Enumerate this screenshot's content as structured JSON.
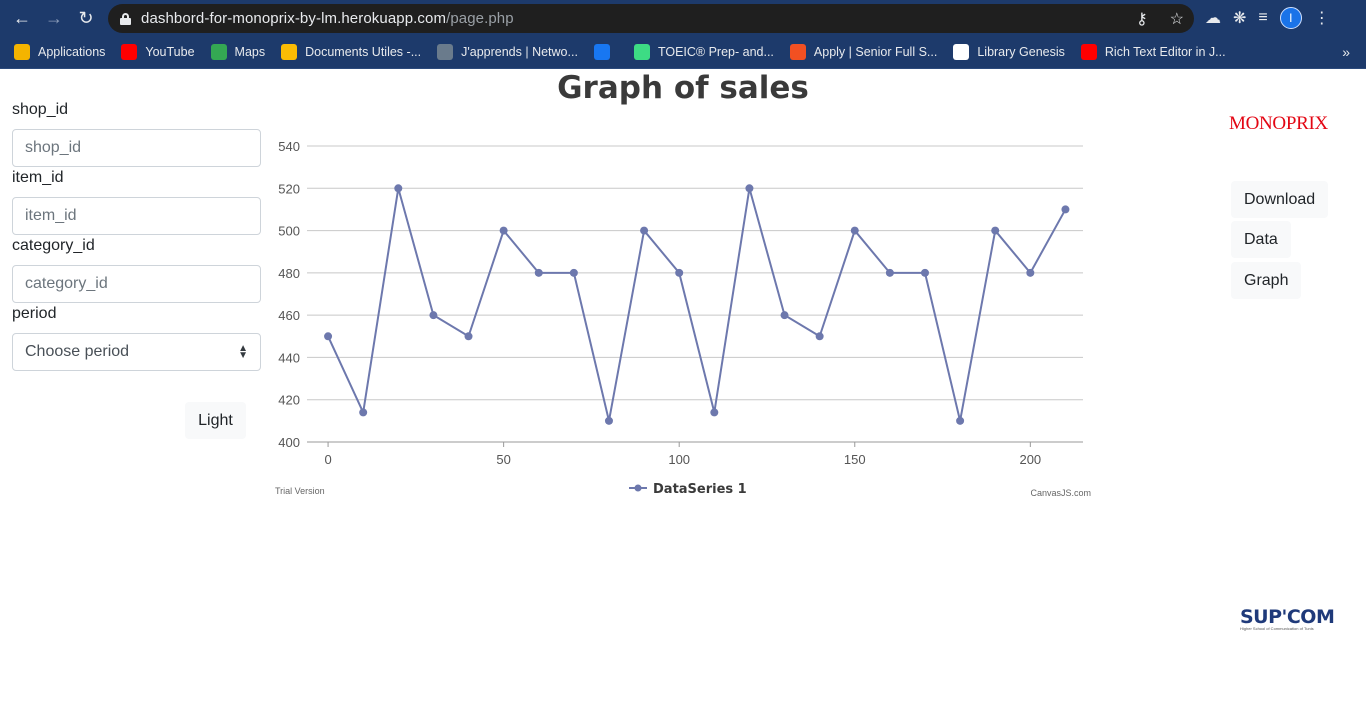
{
  "browser": {
    "url_host": "dashbord-for-monoprix-by-lm.herokuapp.com",
    "url_path": "/page.php",
    "profile_initial": "I",
    "bookmarks": [
      {
        "label": "Applications",
        "icon": "apps-grid-icon",
        "color": "#f4b400"
      },
      {
        "label": "YouTube",
        "icon": "youtube-icon",
        "color": "#ff0000"
      },
      {
        "label": "Maps",
        "icon": "maps-icon",
        "color": "#34a853"
      },
      {
        "label": "Documents Utiles -...",
        "icon": "drive-icon",
        "color": "#fbbc04"
      },
      {
        "label": "J'apprends | Netwo...",
        "icon": "cisco-icon",
        "color": "#6a7b8c"
      },
      {
        "label": "",
        "icon": "facebook-icon",
        "color": "#1877f2"
      },
      {
        "label": "TOEIC® Prep- and...",
        "icon": "check-icon",
        "color": "#3ddc84"
      },
      {
        "label": "Apply | Senior Full S...",
        "icon": "microsoft-icon",
        "color": "#f25022"
      },
      {
        "label": "Library Genesis",
        "icon": "book-icon",
        "color": "#ffffff"
      },
      {
        "label": "Rich Text Editor in J...",
        "icon": "youtube-icon",
        "color": "#ff0000"
      }
    ],
    "more": "»"
  },
  "form": {
    "shop_label": "shop_id",
    "shop_placeholder": "shop_id",
    "item_label": "item_id",
    "item_placeholder": "item_id",
    "category_label": "category_id",
    "category_placeholder": "category_id",
    "period_label": "period",
    "period_selected": "Choose period",
    "light_button": "Light"
  },
  "sidebar": {
    "logo": "MONOPRIX",
    "download_button": "Download",
    "data_button": "Data",
    "graph_button": "Graph",
    "footer_logo_main": "SUP'COM",
    "footer_logo_sub": "Higher School of Communication of Tunis"
  },
  "chart_data": {
    "type": "line",
    "title": "Graph of sales",
    "x": [
      0,
      10,
      20,
      30,
      40,
      50,
      60,
      70,
      80,
      90,
      100,
      110,
      120,
      130,
      140,
      150,
      160,
      170,
      180,
      190,
      200,
      210
    ],
    "series": [
      {
        "name": "DataSeries 1",
        "color": "#6d78ad",
        "values": [
          450,
          414,
          520,
          460,
          450,
          500,
          480,
          480,
          410,
          500,
          480,
          414,
          520,
          460,
          450,
          500,
          480,
          480,
          410,
          500,
          480,
          510
        ]
      }
    ],
    "x_ticks": [
      0,
      50,
      100,
      150,
      200
    ],
    "y_ticks": [
      400,
      420,
      440,
      460,
      480,
      500,
      520,
      540
    ],
    "xlim": [
      -6,
      215
    ],
    "ylim": [
      400,
      540
    ],
    "grid": "horizontal",
    "legend": "bottom-center",
    "watermark_left": "Trial Version",
    "watermark_right": "CanvasJS.com"
  }
}
